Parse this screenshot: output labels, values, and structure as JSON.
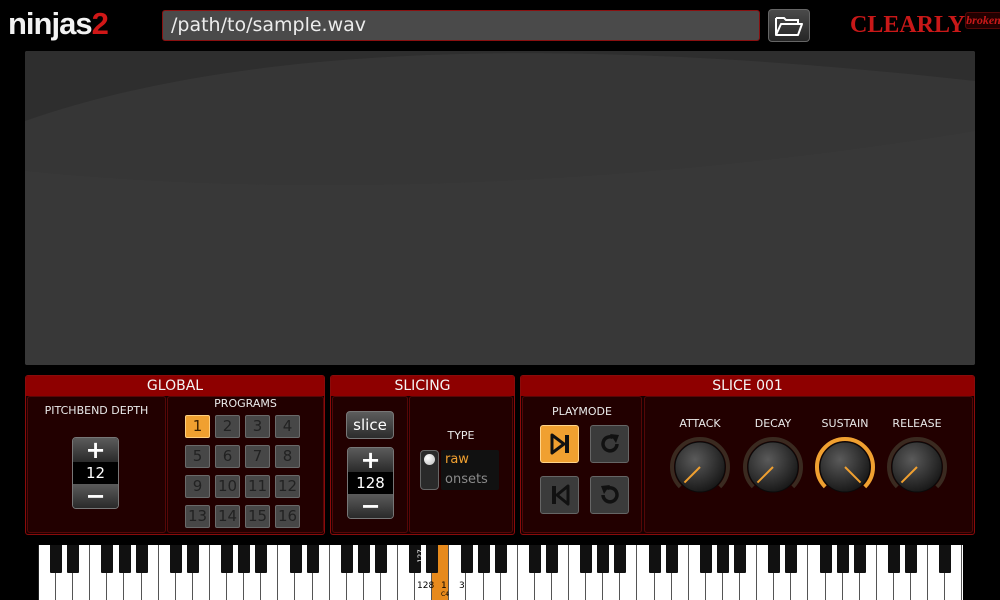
{
  "header": {
    "logo_main": "ninjas",
    "logo_num": "2",
    "file_path": "/path/to/sample.wav",
    "brand_main": "CLEARLY",
    "brand_sub": "broken",
    "open_icon": "folder-open-icon"
  },
  "colors": {
    "accent": "#f0a030",
    "panel_title_bg": "#8e0000",
    "panel_bg": "#170000",
    "brand": "#c81818"
  },
  "global": {
    "title": "GLOBAL",
    "pitchbend_label": "PITCHBEND DEPTH",
    "pitchbend_value": "12",
    "plus": "+",
    "minus": "−",
    "programs_label": "PROGRAMS",
    "programs": [
      "1",
      "2",
      "3",
      "4",
      "5",
      "6",
      "7",
      "8",
      "9",
      "10",
      "11",
      "12",
      "13",
      "14",
      "15",
      "16"
    ],
    "active_program": "1"
  },
  "slicing": {
    "title": "SLICING",
    "slice_button": "slice",
    "slices_value": "128",
    "plus": "+",
    "minus": "−",
    "type_label": "TYPE",
    "type_options": [
      "raw",
      "onsets"
    ],
    "type_selected": "raw"
  },
  "slice": {
    "title": "SLICE 001",
    "playmode_label": "PLAYMODE",
    "playmode_buttons": [
      {
        "icon": "play-to-end-icon",
        "active": true
      },
      {
        "icon": "loop-forward-icon",
        "active": false
      },
      {
        "icon": "play-reverse-icon",
        "active": false
      },
      {
        "icon": "loop-reverse-icon",
        "active": false
      }
    ],
    "adsr": [
      {
        "label": "ATTACK",
        "level": 0.0
      },
      {
        "label": "DECAY",
        "level": 0.0
      },
      {
        "label": "SUSTAIN",
        "level": 1.0
      },
      {
        "label": "RELEASE",
        "level": 0.0
      }
    ]
  },
  "keyboard": {
    "label_127": "127",
    "label_2": "2",
    "label_128": "128",
    "label_1": "1",
    "label_c4": "C4",
    "label_3": "3"
  }
}
